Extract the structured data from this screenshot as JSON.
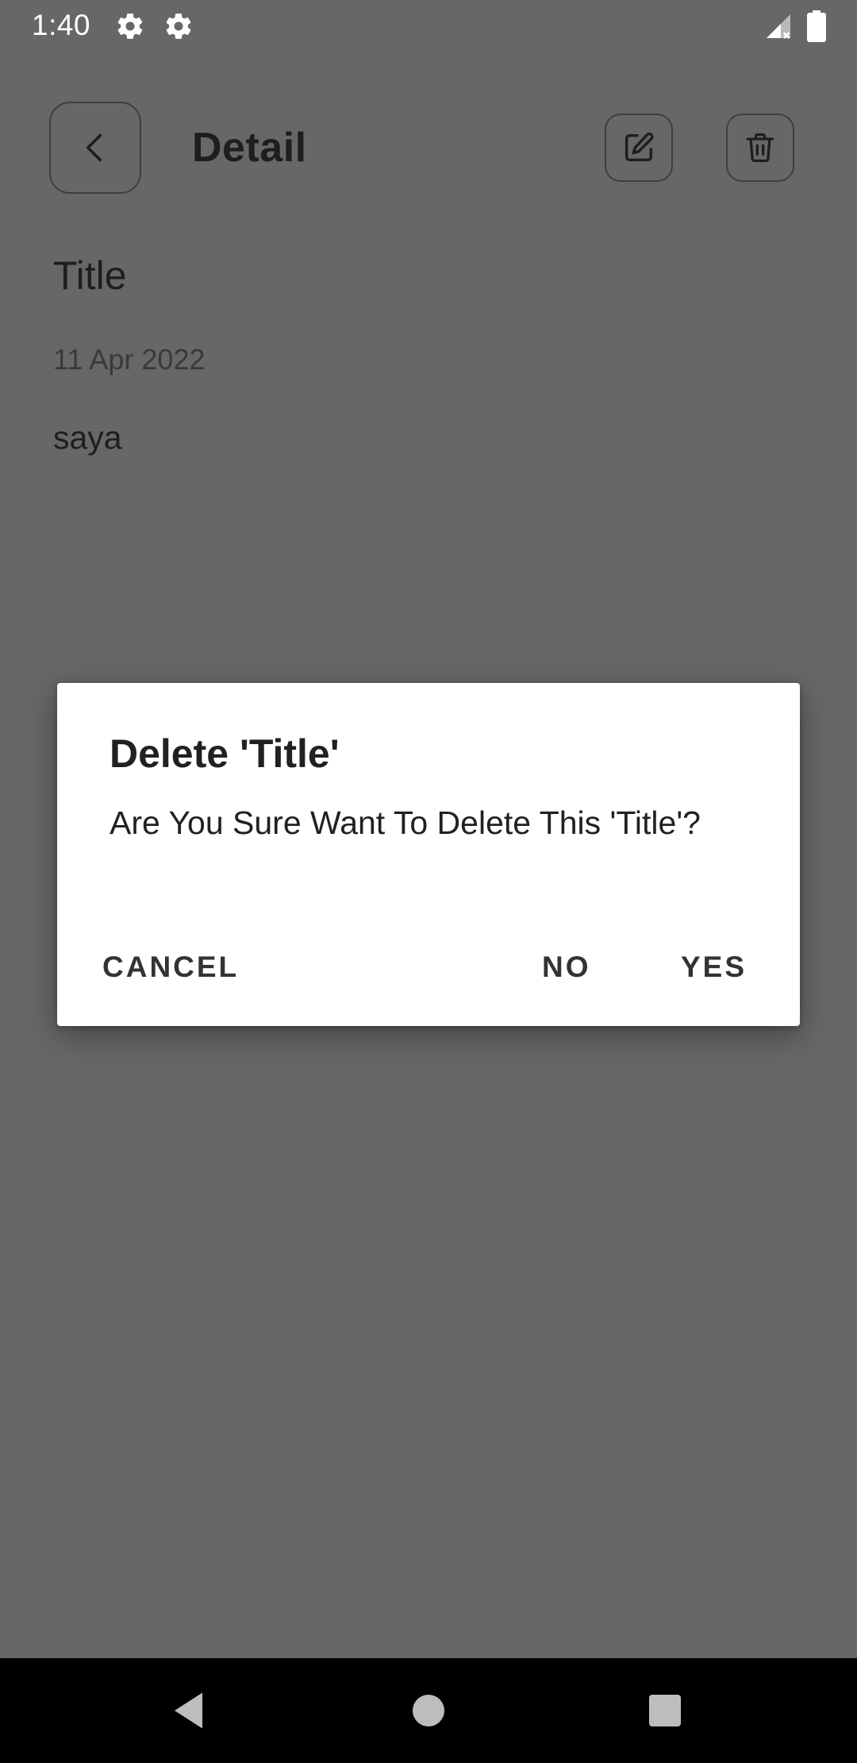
{
  "status_bar": {
    "time": "1:40",
    "icons": [
      "gear-icon",
      "gear-icon",
      "signal-icon",
      "battery-icon"
    ]
  },
  "header": {
    "title": "Detail",
    "back_icon": "chevron-left-icon",
    "edit_icon": "edit-icon",
    "delete_icon": "trash-icon"
  },
  "note": {
    "title": "Title",
    "date": "11 Apr 2022",
    "body": "saya"
  },
  "dialog": {
    "title": "Delete 'Title'",
    "message": "Are You Sure Want To Delete This 'Title'?",
    "cancel_label": "CANCEL",
    "no_label": "NO",
    "yes_label": "YES"
  },
  "nav_bar": {
    "icons": [
      "back-triangle-icon",
      "home-circle-icon",
      "recents-square-icon"
    ]
  },
  "colors": {
    "scrim_background": "#676767",
    "dialog_background": "#ffffff",
    "nav_bar": "#000000"
  }
}
